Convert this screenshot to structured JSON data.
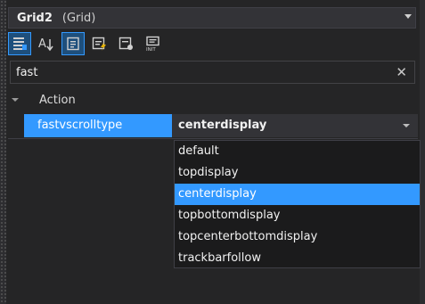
{
  "object_selector": {
    "name": "Grid2",
    "type": "(Grid)"
  },
  "toolbar": {
    "buttons": [
      {
        "icon": "categorized-icon",
        "active": true
      },
      {
        "icon": "alphabetical-sort-icon",
        "active": false
      },
      {
        "icon": "properties-icon",
        "active": true
      },
      {
        "icon": "events-icon",
        "active": false
      },
      {
        "icon": "style-icon",
        "active": false
      },
      {
        "icon": "init-icon",
        "active": false
      }
    ]
  },
  "search": {
    "value": "fast",
    "clear_glyph": "✕"
  },
  "category": {
    "label": "Action"
  },
  "property": {
    "name": "fastvscrolltype",
    "value": "centerdisplay"
  },
  "dropdown": {
    "options": [
      "default",
      "topdisplay",
      "centerdisplay",
      "topbottomdisplay",
      "topcenterbottomdisplay",
      "trackbarfollow"
    ],
    "selected": "centerdisplay"
  },
  "colors": {
    "accent": "#3399ff",
    "background": "#252526"
  }
}
